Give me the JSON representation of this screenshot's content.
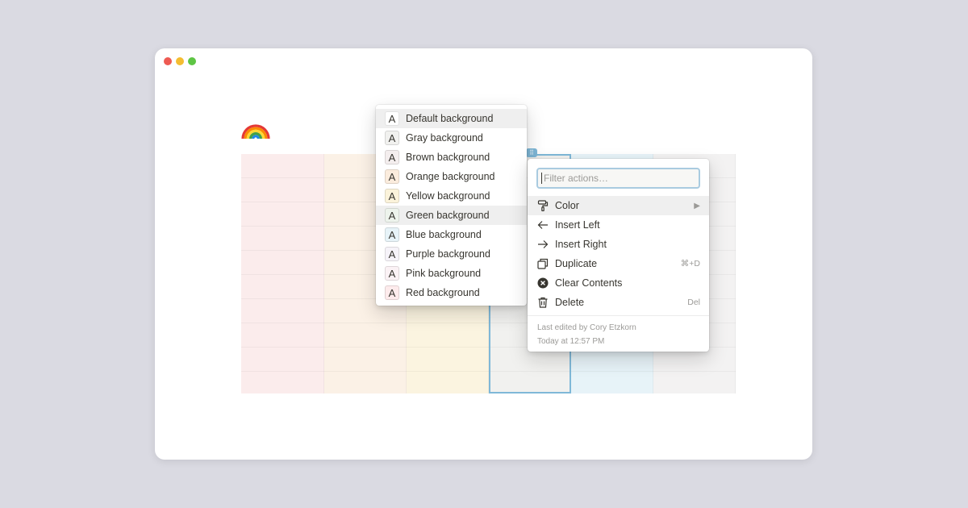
{
  "colors": {
    "default": "#ffffff",
    "gray": "#f1f1ef",
    "brown": "#f4eeee",
    "orange": "#fbecdd",
    "yellow": "#fbf3db",
    "green": "#edf3ec",
    "blue": "#e7f3f8",
    "purple": "#f6f3f9",
    "pink": "#fbf2f5",
    "red": "#fdebec"
  },
  "color_menu": {
    "swatch_letter": "A",
    "items": [
      {
        "label": "Default background"
      },
      {
        "label": "Gray background"
      },
      {
        "label": "Brown background"
      },
      {
        "label": "Orange background"
      },
      {
        "label": "Yellow background"
      },
      {
        "label": "Green background"
      },
      {
        "label": "Blue background"
      },
      {
        "label": "Purple background"
      },
      {
        "label": "Pink background"
      },
      {
        "label": "Red background"
      }
    ]
  },
  "action_menu": {
    "filter_placeholder": "Filter actions…",
    "items": [
      {
        "label": "Color",
        "icon": "paint-roller-icon",
        "submenu_icon": "▶"
      },
      {
        "label": "Insert Left",
        "icon": "arrow-left-icon"
      },
      {
        "label": "Insert Right",
        "icon": "arrow-right-icon"
      },
      {
        "label": "Duplicate",
        "icon": "duplicate-icon",
        "shortcut": "⌘+D"
      },
      {
        "label": "Clear Contents",
        "icon": "clear-icon"
      },
      {
        "label": "Delete",
        "icon": "trash-icon",
        "shortcut": "Del"
      }
    ],
    "footer": {
      "edited_by": "Last edited by Cory Etzkorn",
      "time": "Today at 12:57 PM"
    }
  },
  "page": {
    "icon": "rainbow-icon"
  },
  "column_handle_icon": "⠿"
}
